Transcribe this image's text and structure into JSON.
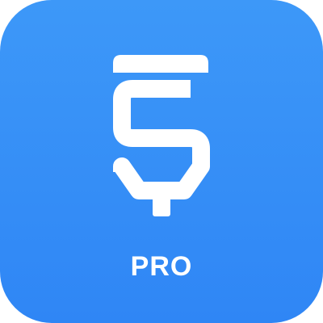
{
  "app_icon": {
    "name": "sketchware-pro",
    "icon": "pen-nib-s-icon",
    "label": "PRO",
    "colors": {
      "background_top": "#3d98f8",
      "background_bottom": "#2f86f5",
      "foreground": "#ffffff"
    }
  }
}
